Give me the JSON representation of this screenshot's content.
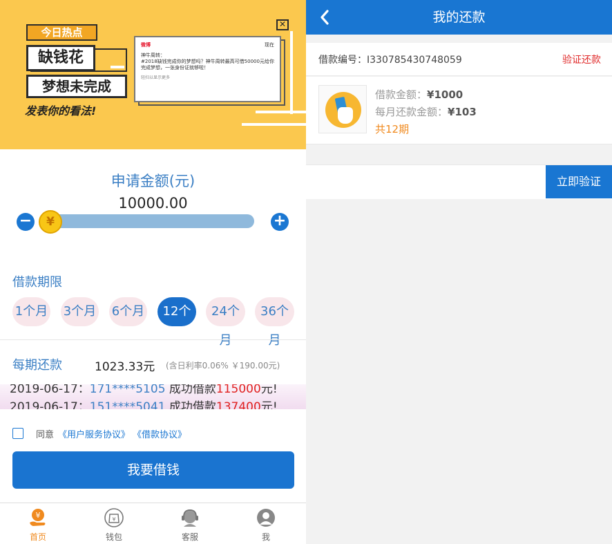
{
  "left": {
    "banner": {
      "hot_tag": "今日热点",
      "headline_1": "缺钱花",
      "headline_2": "梦想未完成",
      "slogan": "发表你的看法!",
      "weibo": {
        "brand": "微博",
        "action": "现在",
        "author": "神牛周转：",
        "text": "#2018缺钱完成你的梦想吗？神牛周转最高可借50000元给你完成梦想，一张身份证就够啦！",
        "more": "轻扫以显示更多"
      }
    },
    "amount": {
      "title": "申请金额(元)",
      "value": "10000.00",
      "knob_symbol": "¥",
      "minus": "−",
      "plus": "+",
      "slider_fraction": 0.0
    },
    "term": {
      "label": "借款期限",
      "options": [
        "1个月",
        "3个月",
        "6个月",
        "12个月",
        "24个月",
        "36个月"
      ],
      "selected": "12个月"
    },
    "payment": {
      "label": "每期还款",
      "value": "1023.33元",
      "note": "(含日利率0.06% ￥190.00元)"
    },
    "ticker": {
      "line1_date": "2019-06-17：",
      "line1_num": "171****5105",
      "line1_text": "成功借款",
      "line1_money": "115000",
      "line1_unit": "元!",
      "line2_date": "2019-06-17：",
      "line2_num": "151****5041",
      "line2_text": "成功借款",
      "line2_money": "137400",
      "line2_unit": "元!"
    },
    "agreement": {
      "prefix": "同意",
      "link_1": "《用户服务协议》",
      "link_2": "《借款协议》"
    },
    "borrow_button": "我要借钱",
    "tabbar": {
      "items": [
        {
          "label": "首页",
          "icon": "home-yen-icon"
        },
        {
          "label": "钱包",
          "icon": "wallet-icon"
        },
        {
          "label": "客服",
          "icon": "customer-service-icon"
        },
        {
          "label": "我",
          "icon": "user-icon"
        }
      ],
      "active": "首页"
    }
  },
  "right": {
    "nav": {
      "back": "‹",
      "title": "我的还款"
    },
    "loan_no": "借款编号：I330785430748059",
    "verify_repay_link": "验证还款",
    "loan": {
      "amount_label": "借款金额：",
      "amount_value": "¥1000",
      "monthly_label": "每月还款金额：",
      "monthly_value": "¥103",
      "term": "共12期"
    },
    "verify_button": "立即验证"
  },
  "colors": {
    "primary": "#1976d2",
    "banner_yellow": "#fbc84e",
    "accent_orange": "#f08a1f",
    "alert_red": "#e02a2a",
    "pill_pink": "#f8e6ea"
  }
}
